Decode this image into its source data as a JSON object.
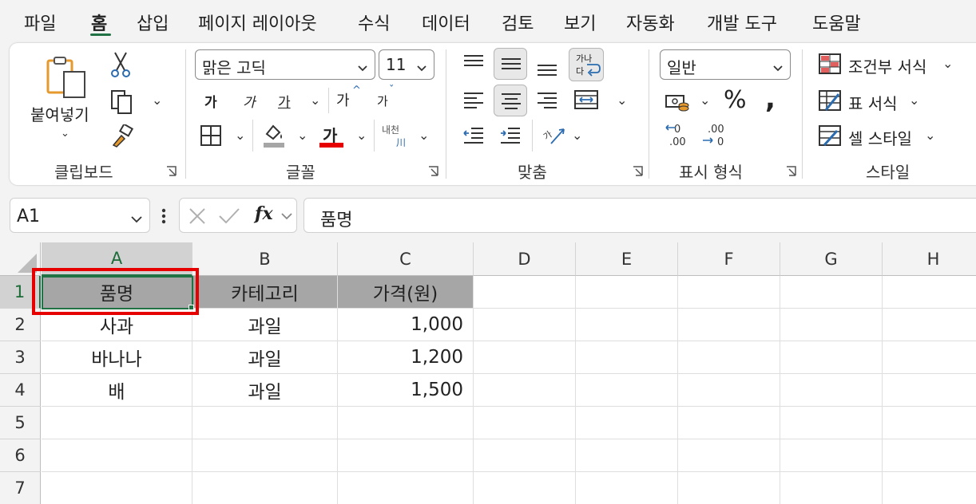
{
  "menu": {
    "tabs": [
      "파일",
      "홈",
      "삽입",
      "페이지 레이아웃",
      "수식",
      "데이터",
      "검토",
      "보기",
      "자동화",
      "개발 도구",
      "도움말"
    ],
    "active": "홈"
  },
  "ribbon": {
    "clipboard": {
      "paste_label": "붙여넣기",
      "group_label": "클립보드"
    },
    "font": {
      "font_name": "맑은 고딕",
      "font_size": "11",
      "bold_label": "가",
      "italic_label": "가",
      "underline_label": "가",
      "grow_label": "가",
      "shrink_label": "가",
      "font_color_label": "가",
      "phonetic_top": "내천",
      "phonetic_bottom": "川",
      "group_label": "글꼴"
    },
    "alignment": {
      "wrap_top": "가나",
      "wrap_bottom": "다",
      "group_label": "맞춤"
    },
    "number": {
      "format": "일반",
      "group_label": "표시 형식"
    },
    "styles": {
      "conditional": "조건부 서식",
      "table": "표 서식",
      "cell": "셀 스타일",
      "group_label": "스타일"
    }
  },
  "formula_bar": {
    "name_box": "A1",
    "fx": "fx",
    "content": "품명"
  },
  "sheet": {
    "columns": [
      "A",
      "B",
      "C",
      "D",
      "E",
      "F",
      "G",
      "H"
    ],
    "rows": [
      "1",
      "2",
      "3",
      "4",
      "5",
      "6",
      "7"
    ],
    "selected_cell": "A1",
    "data": [
      [
        "품명",
        "카테고리",
        "가격(원)"
      ],
      [
        "사과",
        "과일",
        "1,000"
      ],
      [
        "바나나",
        "과일",
        "1,200"
      ],
      [
        "배",
        "과일",
        "1,500"
      ]
    ]
  },
  "colors": {
    "accent": "#217346",
    "header_fill": "#a6a6a6",
    "highlight": "#e60000"
  }
}
